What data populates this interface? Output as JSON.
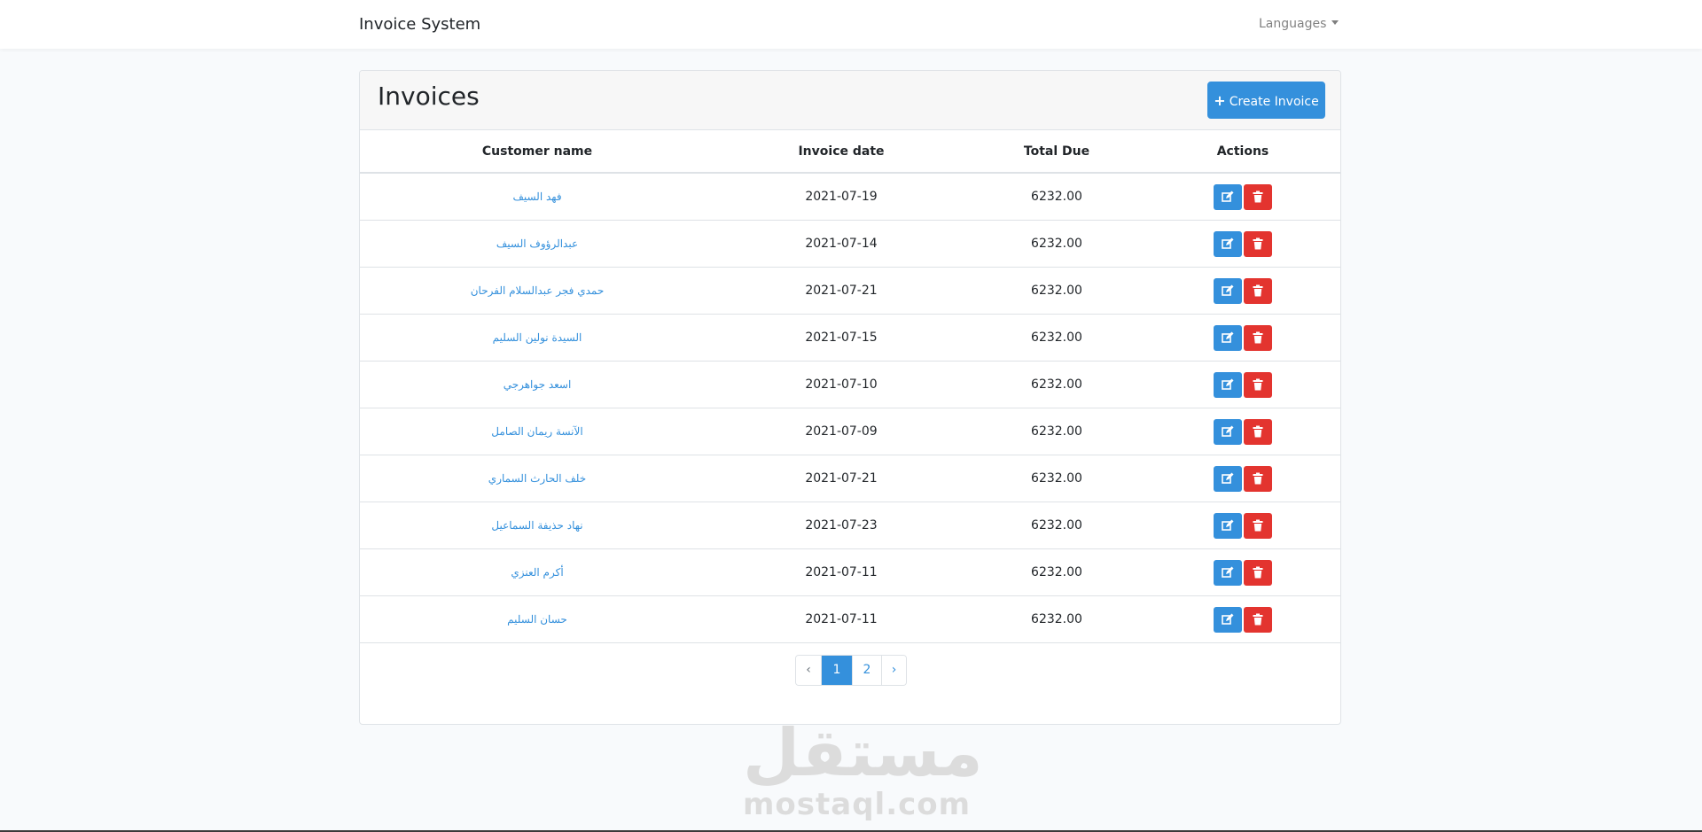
{
  "navbar": {
    "brand": "Invoice System",
    "languages_label": "Languages"
  },
  "card": {
    "title": "Invoices",
    "create_button_label": "Create Invoice"
  },
  "table": {
    "headers": [
      "Customer name",
      "Invoice date",
      "Total Due",
      "Actions"
    ],
    "rows": [
      {
        "customer": "فهد السيف",
        "date": "2021-07-19",
        "total": "6232.00"
      },
      {
        "customer": "عبدالرؤوف السيف",
        "date": "2021-07-14",
        "total": "6232.00"
      },
      {
        "customer": "حمدي فجر عبدالسلام الفرحان",
        "date": "2021-07-21",
        "total": "6232.00"
      },
      {
        "customer": "السيدة نولين السليم",
        "date": "2021-07-15",
        "total": "6232.00"
      },
      {
        "customer": "اسعد جواهرجي",
        "date": "2021-07-10",
        "total": "6232.00"
      },
      {
        "customer": "الآنسة ريمان الصامل",
        "date": "2021-07-09",
        "total": "6232.00"
      },
      {
        "customer": "خلف الحارث السماري",
        "date": "2021-07-21",
        "total": "6232.00"
      },
      {
        "customer": "نهاد حذيفة السماعيل",
        "date": "2021-07-23",
        "total": "6232.00"
      },
      {
        "customer": "أكرم العنزي",
        "date": "2021-07-11",
        "total": "6232.00"
      },
      {
        "customer": "حسان السليم",
        "date": "2021-07-11",
        "total": "6232.00"
      }
    ]
  },
  "pagination": {
    "prev": "‹",
    "pages": [
      "1",
      "2"
    ],
    "next": "›",
    "active_page": "1"
  },
  "watermark": {
    "arabic": "مستقل",
    "latin": "mostaql.com"
  },
  "colors": {
    "primary": "#3490dc",
    "danger": "#e3342f"
  }
}
